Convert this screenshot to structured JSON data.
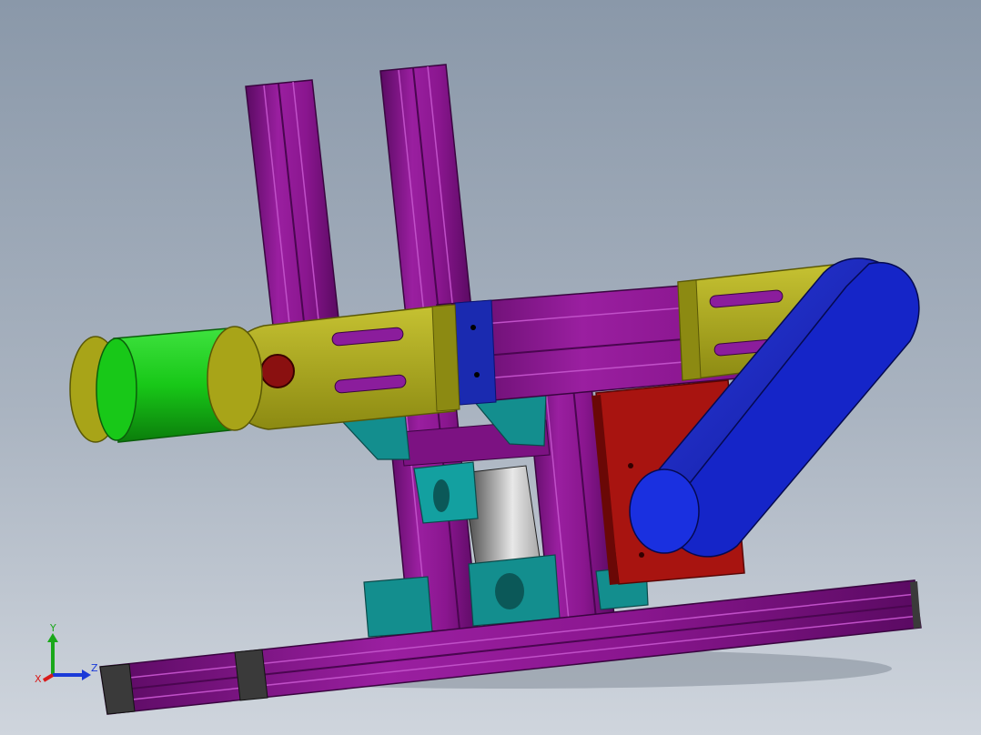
{
  "colors": {
    "profile": "#8a168f",
    "profile_dark": "#5a0a62",
    "profile_light": "#b43cb8",
    "plate": "#a8a418",
    "plate_dark": "#6e6c08",
    "roller": "#18c818",
    "roller_dark": "#0b7d0b",
    "belt": "#1525c8",
    "belt_dark": "#0a1278",
    "motor_plate": "#a81410",
    "motor_plate_dark": "#6a0806",
    "bracket": "#138e8e",
    "bracket_dark": "#0b5858",
    "slot": "#8b1d9c",
    "end_cap": "#3a3a3a",
    "shaft": "#8a1010"
  },
  "triad": {
    "y_label": "Y",
    "z_label": "Z",
    "x_label": "X",
    "y_color": "#1aa81a",
    "z_color": "#1a3ad8",
    "x_color": "#d81a1a"
  }
}
